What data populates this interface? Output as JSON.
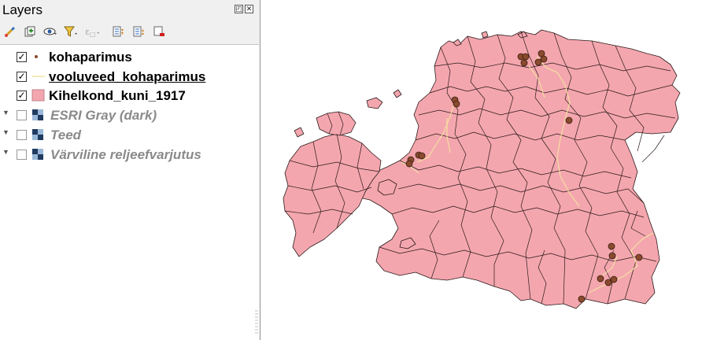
{
  "panel": {
    "title": "Layers",
    "title_buttons": [
      "float-icon",
      "close-icon"
    ]
  },
  "toolbar": {
    "buttons": [
      {
        "name": "style-manager-icon"
      },
      {
        "name": "add-group-icon"
      },
      {
        "name": "eye-visibility-icon"
      },
      {
        "name": "filter-legend-icon"
      },
      {
        "name": "filter-expression-icon"
      },
      {
        "name": "expand-all-icon"
      },
      {
        "name": "collapse-all-icon"
      },
      {
        "name": "remove-layer-icon"
      }
    ]
  },
  "layers": [
    {
      "label": "kohaparimus",
      "checked": true,
      "symbol": "point"
    },
    {
      "label": "vooluveed_kohaparimus",
      "checked": true,
      "symbol": "line"
    },
    {
      "label": "Kihelkond_kuni_1917",
      "checked": true,
      "symbol": "polygon"
    },
    {
      "label": "ESRI Gray (dark)",
      "checked": false,
      "symbol": "raster"
    },
    {
      "label": "Teed",
      "checked": false,
      "symbol": "raster"
    },
    {
      "label": "Värviline reljeefvarjutus",
      "checked": false,
      "symbol": "raster"
    }
  ],
  "colors": {
    "polygon_fill": "#f4a6ae",
    "polygon_stroke": "#2b1a1a",
    "point_fill": "#8a4a2e",
    "line_color": "#f3e3a0"
  }
}
